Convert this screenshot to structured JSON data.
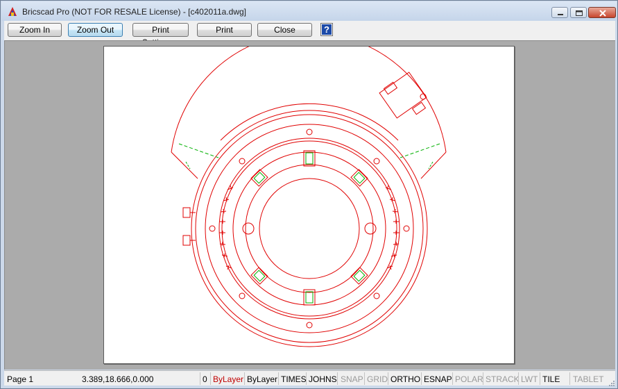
{
  "window": {
    "title": "Bricscad Pro (NOT FOR RESALE License) - [c402011a.dwg]",
    "icon": "bricscad-app-icon"
  },
  "toolbar": {
    "zoom_in": "Zoom In",
    "zoom_out": "Zoom Out",
    "print_settings": "Print Settings...",
    "print": "Print",
    "close": "Close",
    "help": "?"
  },
  "drawing": {
    "description_icon": "cad-drawing-preview",
    "line_color": "#e00000",
    "accent_color": "#00b000"
  },
  "status": {
    "page": "Page 1",
    "coords": "3.389,18.666,0.000",
    "layer": "0",
    "color": "ByLayer",
    "linetype": "ByLayer",
    "textstyle": "TIMES",
    "dimstyle": "JOHNS",
    "snap": "SNAP",
    "grid": "GRID",
    "ortho": "ORTHO",
    "esnap": "ESNAP",
    "polar": "POLAR",
    "strack": "STRACK",
    "lwt": "LWT",
    "tile": "TILE",
    "tablet": "TABLET"
  }
}
